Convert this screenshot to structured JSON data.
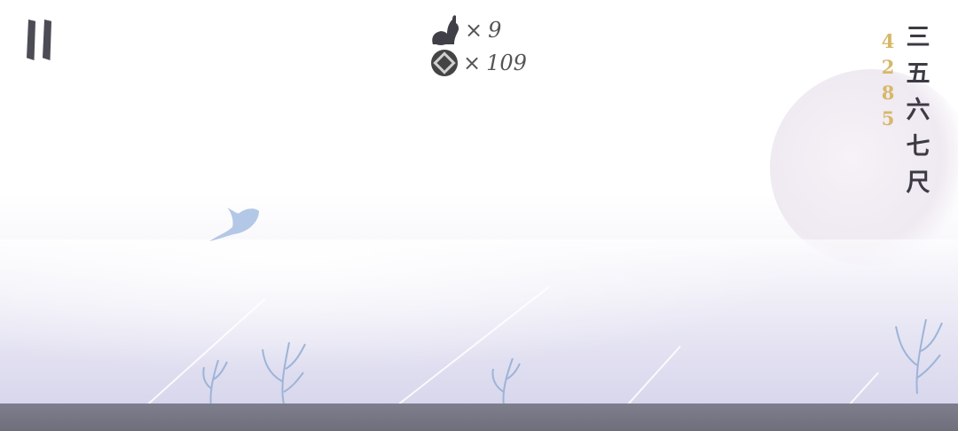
{
  "hud": {
    "pause_icon": "pause-icon",
    "rabbit": {
      "icon": "rabbit-icon",
      "multiplier": "×",
      "count": "9"
    },
    "coins": {
      "icon": "square-hole-coin-icon",
      "multiplier": "×",
      "count": "109"
    }
  },
  "distance": {
    "digits": [
      "4",
      "2",
      "8",
      "5"
    ],
    "color": "#d6b86a"
  },
  "level_name": {
    "chars": [
      "三",
      "五",
      "六",
      "七",
      "尺"
    ],
    "color": "#3c3b44"
  },
  "scene": {
    "player": "bird-icon",
    "plants": "frosted-plant-icon",
    "ground_color": "#74737f",
    "moon": "moon-icon"
  }
}
